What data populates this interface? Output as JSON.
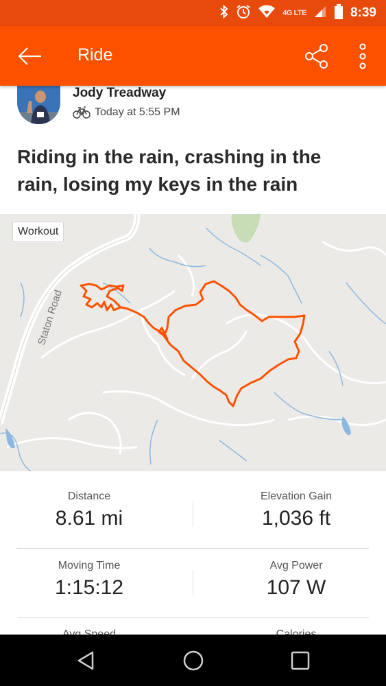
{
  "status_bar": {
    "time": "8:39",
    "network": "4G LTE",
    "icons": [
      "bluetooth-icon",
      "alarm-icon",
      "wifi-icon",
      "signal-icon",
      "battery-icon"
    ]
  },
  "app_bar": {
    "title": "Ride",
    "back_icon": "arrow-back-icon",
    "share_icon": "share-icon",
    "more_icon": "more-vert-icon"
  },
  "activity": {
    "athlete_name": "Jody Treadway",
    "sport_icon": "bike-icon",
    "timestamp": "Today at 5:55 PM",
    "title": "Riding in the rain, crashing in the rain, losing my keys in the rain"
  },
  "map": {
    "badge": "Workout",
    "road_label": "Staton Road",
    "route_color": "#FC5200"
  },
  "stats": [
    {
      "label": "Distance",
      "value": "8.61 mi"
    },
    {
      "label": "Elevation Gain",
      "value": "1,036 ft"
    },
    {
      "label": "Moving Time",
      "value": "1:15:12"
    },
    {
      "label": "Avg Power",
      "value": "107 W"
    },
    {
      "label": "Avg Speed",
      "value": ""
    },
    {
      "label": "Calories",
      "value": ""
    }
  ],
  "nav": {
    "back_icon": "nav-back-icon",
    "home_icon": "nav-home-icon",
    "recents_icon": "nav-recents-icon"
  },
  "colors": {
    "accent": "#FC5200",
    "status_bar": "#E84A0C"
  }
}
